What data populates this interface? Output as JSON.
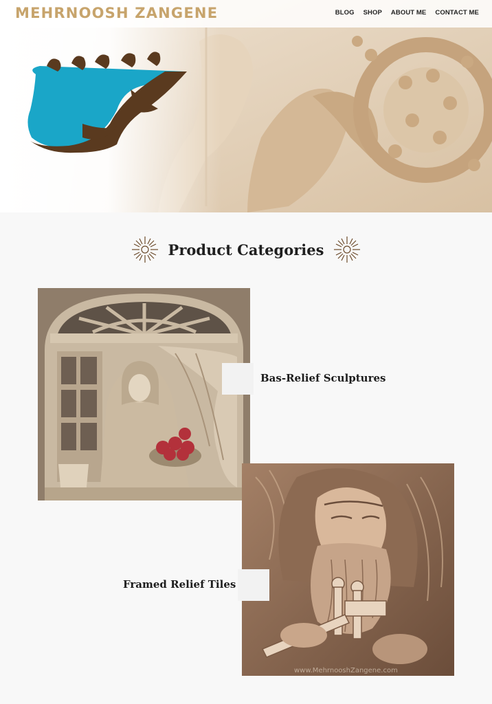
{
  "header": {
    "brand": "MEHRNOOSH ZANGENE",
    "nav": [
      "BLOG",
      "SHOP",
      "ABOUT ME",
      "CONTACT ME"
    ]
  },
  "hero": {
    "logo_icon": "persian-calligraphy-logo",
    "image": "bas-relief-wall-sculpture"
  },
  "categories_section": {
    "title": "Product Categories",
    "ornament_icon": "sun-sparkle-icon"
  },
  "categories": [
    {
      "label": "Bas-Relief Sculptures",
      "image": "woman-at-window-relief"
    },
    {
      "label": "Framed Relief Tiles",
      "image": "old-man-playing-instrument-relief"
    }
  ],
  "watermark": "www.MehrnooshZangene.com",
  "colors": {
    "brand": "#c7a46c",
    "logo_teal": "#1aa6c8",
    "logo_brown": "#5a3a1f",
    "ornament": "#6b4a2a",
    "page_bg": "#f8f8f8"
  }
}
